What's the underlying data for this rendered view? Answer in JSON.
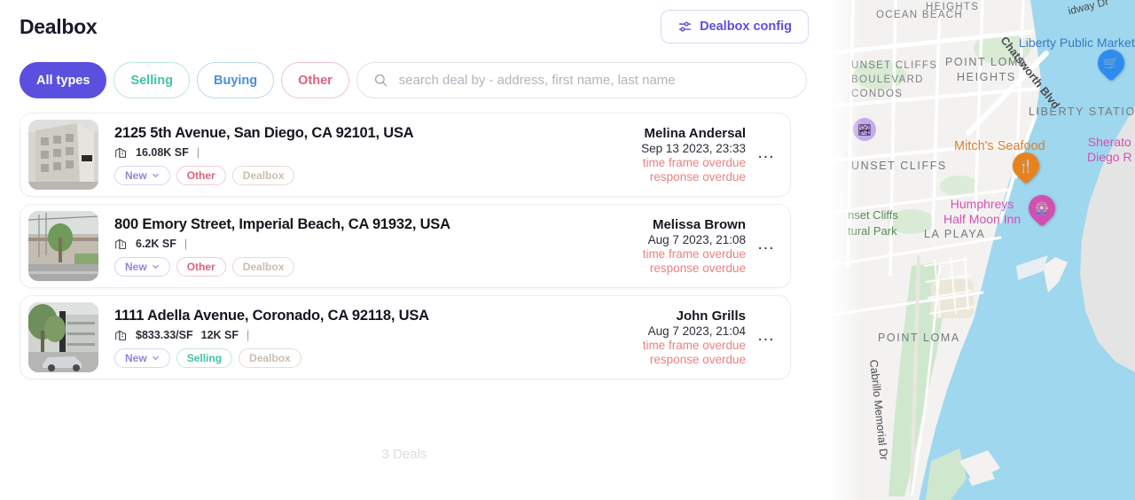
{
  "header": {
    "title": "Dealbox",
    "config_button": {
      "label": "Dealbox config",
      "icon": "sliders-icon"
    }
  },
  "filters": {
    "chips": [
      {
        "label": "All types",
        "state": "active"
      },
      {
        "label": "Selling",
        "state": "inactive"
      },
      {
        "label": "Buying",
        "state": "inactive"
      },
      {
        "label": "Other",
        "state": "inactive"
      }
    ],
    "search": {
      "icon": "search-icon",
      "placeholder": "search deal by - address, first name, last name",
      "value": ""
    }
  },
  "deals": [
    {
      "address": "2125 5th Avenue, San Diego, CA 92101, USA",
      "metric_primary": "",
      "metric_size": "16.08K SF",
      "metric_separator": "|",
      "tags": [
        {
          "label": "New",
          "kind": "new",
          "has_chevron": true
        },
        {
          "label": "Other",
          "kind": "other",
          "has_chevron": false
        },
        {
          "label": "Dealbox",
          "kind": "dealbox",
          "has_chevron": false
        }
      ],
      "contact_name": "Melina Andersal",
      "date": "Sep 13 2023, 23:33",
      "alert_1": "time frame overdue",
      "alert_2": "response overdue",
      "menu": "…"
    },
    {
      "address": "800 Emory Street, Imperial Beach, CA 91932, USA",
      "metric_primary": "",
      "metric_size": "6.2K SF",
      "metric_separator": "|",
      "tags": [
        {
          "label": "New",
          "kind": "new",
          "has_chevron": true
        },
        {
          "label": "Other",
          "kind": "other",
          "has_chevron": false
        },
        {
          "label": "Dealbox",
          "kind": "dealbox",
          "has_chevron": false
        }
      ],
      "contact_name": "Melissa Brown",
      "date": "Aug 7 2023, 21:08",
      "alert_1": "time frame overdue",
      "alert_2": "response overdue",
      "menu": "…"
    },
    {
      "address": "1111 Adella Avenue, Coronado, CA 92118, USA",
      "metric_primary": "$833.33/SF",
      "metric_size": "12K SF",
      "metric_separator": "|",
      "tags": [
        {
          "label": "New",
          "kind": "new",
          "has_chevron": true
        },
        {
          "label": "Selling",
          "kind": "selling",
          "has_chevron": false
        },
        {
          "label": "Dealbox",
          "kind": "dealbox",
          "has_chevron": false
        }
      ],
      "contact_name": "John Grills",
      "date": "Aug 7 2023, 21:04",
      "alert_1": "time frame overdue",
      "alert_2": "response overdue",
      "menu": "…"
    }
  ],
  "footer": {
    "deal_count": "3 Deals"
  },
  "map": {
    "labels": [
      {
        "id": "heights",
        "text": "HEIGHTS",
        "style": "area"
      },
      {
        "id": "ocean-beach",
        "text": "OCEAN BEACH",
        "style": "area"
      },
      {
        "id": "midway-dr",
        "text": "idway Dr",
        "style": "road"
      },
      {
        "id": "liberty-market",
        "text": "Liberty Public Market",
        "style": "poi-blue"
      },
      {
        "id": "sunset-cliffs-blvd-condos",
        "text": "UNSET CLIFFS\nBOULEVARD\nCONDOS",
        "style": "area"
      },
      {
        "id": "point-loma-heights",
        "text": "POINT LOMA\nHEIGHTS",
        "style": "area-lg"
      },
      {
        "id": "chatsworth-blvd",
        "text": "Chatsworth Blvd",
        "style": "road"
      },
      {
        "id": "liberty-station",
        "text": "LIBERTY STATION",
        "style": "area-lg"
      },
      {
        "id": "mitchs-seafood",
        "text": "Mitch's Seafood",
        "style": "poi-orange"
      },
      {
        "id": "sheraton",
        "text": "Sherato\nDiego R",
        "style": "poi-pink"
      },
      {
        "id": "humphreys",
        "text": "Humphreys\nHalf Moon Inn",
        "style": "poi-pink"
      },
      {
        "id": "sunset-cliffs",
        "text": "UNSET CLIFFS",
        "style": "area-lg"
      },
      {
        "id": "la-playa",
        "text": "LA PLAYA",
        "style": "area-lg"
      },
      {
        "id": "sunset-cliffs-park",
        "text": "nset Cliffs\ntural Park",
        "style": "park"
      },
      {
        "id": "point-loma",
        "text": "POINT LOMA",
        "style": "area-lg"
      },
      {
        "id": "cabrillo-memorial",
        "text": "Cabrillo Memorial Dr",
        "style": "road"
      }
    ],
    "pins": [
      {
        "id": "shopping-pin",
        "icon": "shopping-cart-icon",
        "color": "#2d8cf0"
      },
      {
        "id": "restaurant-pin",
        "icon": "restaurant-icon",
        "color": "#e8821e"
      },
      {
        "id": "attraction-pin",
        "icon": "attraction-icon",
        "color": "#d34fb0"
      },
      {
        "id": "viewpoint-dot",
        "icon": "viewpoint-icon",
        "color": "#b388e8"
      }
    ],
    "colors": {
      "water": "#9fd7ee",
      "land": "#f3f2f0",
      "park": "#cfe8cd",
      "road": "#ffffff"
    }
  },
  "theme": {
    "accent": "#5b4fe0",
    "alert": "#ec8080",
    "selling": "#3fc3a5",
    "buying": "#4a90d9",
    "other": "#e0607e",
    "dealbox_tag": "#c9bdae"
  }
}
